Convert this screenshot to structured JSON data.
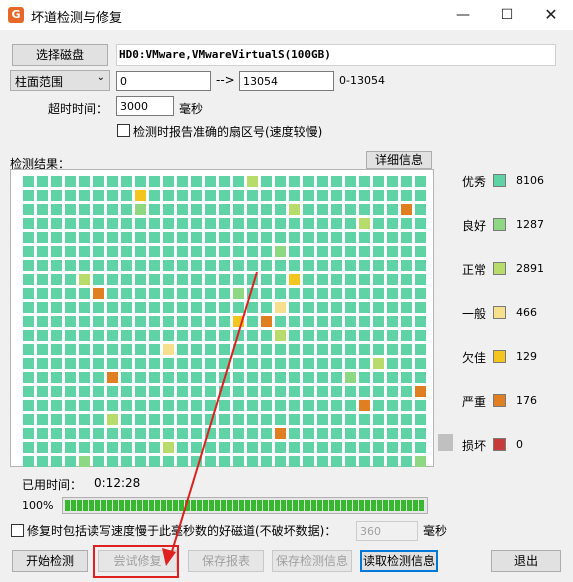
{
  "window": {
    "title": "坏道检测与修复",
    "app_icon": "G"
  },
  "toolbar": {
    "select_disk_label": "选择磁盘",
    "disk_info": "HD0:VMware,VMwareVirtualS(100GB)",
    "range_mode": "柱面范围",
    "range_start": "0",
    "range_arrow": "-->",
    "range_end": "13054",
    "range_hint": "0-13054",
    "timeout_label": "超时时间：",
    "timeout_value": "3000",
    "timeout_unit": "毫秒",
    "report_sector_label": "检测时报告准确的扇区号(速度较慢)"
  },
  "results": {
    "label": "检测结果：",
    "detail_button": "详细信息"
  },
  "legend": [
    {
      "label": "优秀",
      "count": "8106",
      "color": "#5fd3a6"
    },
    {
      "label": "良好",
      "count": "1287",
      "color": "#8ed884"
    },
    {
      "label": "正常",
      "count": "2891",
      "color": "#b8dc6c"
    },
    {
      "label": "一般",
      "count": "466",
      "color": "#f6e08e"
    },
    {
      "label": "欠佳",
      "count": "129",
      "color": "#f4c51f"
    },
    {
      "label": "严重",
      "count": "176",
      "color": "#df7f22"
    },
    {
      "label": "损坏",
      "count": "0",
      "color": "#c83a3a"
    }
  ],
  "status": {
    "elapsed_label": "已用时间：",
    "elapsed_value": "0:12:28",
    "progress_text": "100%",
    "progress_value": 1.0
  },
  "repair_option": {
    "label": "修复时包括读写速度慢于此毫秒数的好磁道(不破坏数据)：",
    "value": "360",
    "unit": "毫秒"
  },
  "actions": {
    "start": "开始检测",
    "try_repair": "尝试修复",
    "save_report": "保存报表",
    "save_info": "保存检测信息",
    "read_info": "读取检测信息",
    "exit": "退出"
  },
  "colors": {
    "accent": "#0078d7",
    "annotation": "#e02020"
  }
}
